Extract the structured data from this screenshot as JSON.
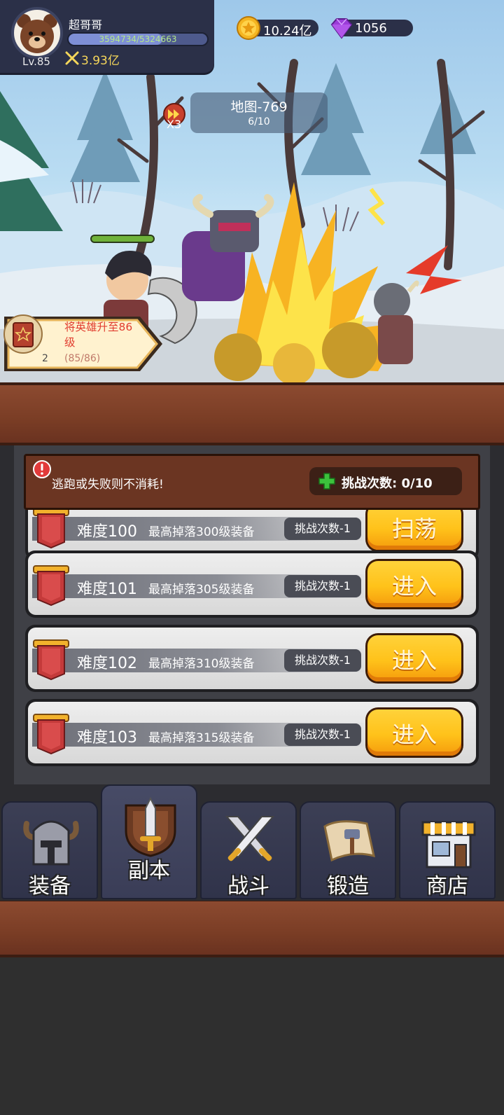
{
  "player": {
    "name": "超哥哥",
    "level": "Lv.85",
    "xp_text": "3594734/5324663",
    "xp_fraction": 0.675,
    "power": "3.93亿",
    "avatar_icon": "bear-avatar-icon"
  },
  "resources": {
    "gold": "10.24亿",
    "gems": "1056"
  },
  "battle": {
    "map_name": "地图-769",
    "map_progress": "6/10",
    "speed_label": "X3"
  },
  "quest": {
    "title": "将英雄升至86级",
    "progress": "(85/86)",
    "badge_count": "2"
  },
  "dungeon": {
    "notice": "逃跑或失败则不消耗!",
    "challenge_label": "挑战次数: 0/10",
    "rows": [
      {
        "title": "难度100",
        "desc": "最高掉落300级装备",
        "count": "挑战次数-1",
        "button": "扫荡"
      },
      {
        "title": "难度101",
        "desc": "最高掉落305级装备",
        "count": "挑战次数-1",
        "button": "进入"
      },
      {
        "title": "难度102",
        "desc": "最高掉落310级装备",
        "count": "挑战次数-1",
        "button": "进入"
      },
      {
        "title": "难度103",
        "desc": "最高掉落315级装备",
        "count": "挑战次数-1",
        "button": "进入"
      }
    ]
  },
  "nav": {
    "tabs": [
      {
        "label": "装备",
        "icon": "helmet-icon"
      },
      {
        "label": "副本",
        "icon": "sword-shield-icon",
        "active": true
      },
      {
        "label": "战斗",
        "icon": "crossed-swords-icon"
      },
      {
        "label": "锻造",
        "icon": "hammer-scroll-icon"
      },
      {
        "label": "商店",
        "icon": "shop-icon"
      }
    ]
  },
  "colors": {
    "hud_bg": "#2b3048",
    "wood": "#7a3d25",
    "button_yellow": "#ffc21a",
    "quest_red": "#e13d2f",
    "power_gold": "#f6d75a"
  }
}
